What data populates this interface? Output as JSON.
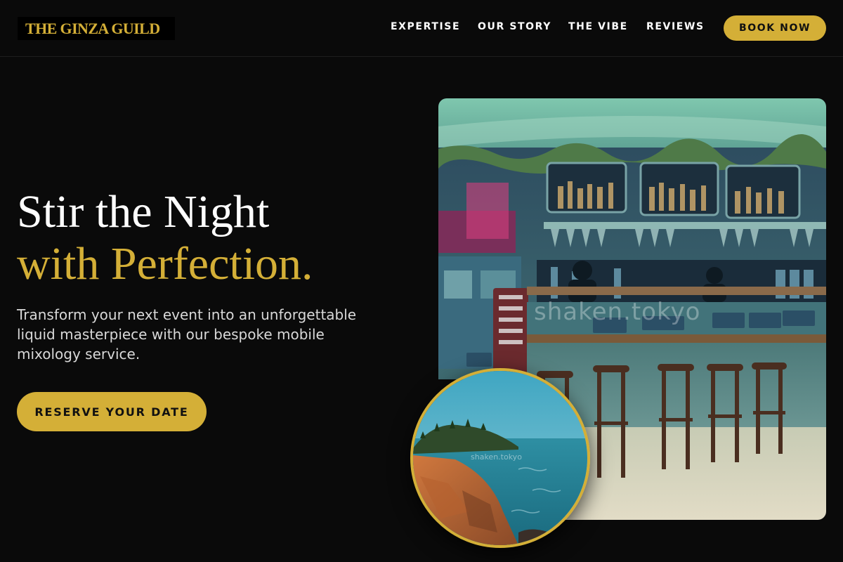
{
  "brand": {
    "name": "THE GINZA GUILD"
  },
  "nav": {
    "links": [
      {
        "label": "EXPERTISE"
      },
      {
        "label": "OUR STORY"
      },
      {
        "label": "THE VIBE"
      },
      {
        "label": "REVIEWS"
      }
    ],
    "cta_label": "BOOK NOW"
  },
  "hero": {
    "title_line1": "Stir the Night",
    "title_line2": "with Perfection.",
    "subtitle": "Transform your next event into an unforgettable liquid masterpiece with our bespoke mobile mixology service.",
    "cta_label": "RESERVE YOUR DATE"
  },
  "images": {
    "bar_watermark": "shaken.tokyo",
    "coast_watermark": "shaken.tokyo"
  },
  "colors": {
    "background": "#0a0a0a",
    "accent_gold": "#d4af37",
    "text_primary": "#ffffff",
    "text_secondary": "#d8d8d8"
  }
}
